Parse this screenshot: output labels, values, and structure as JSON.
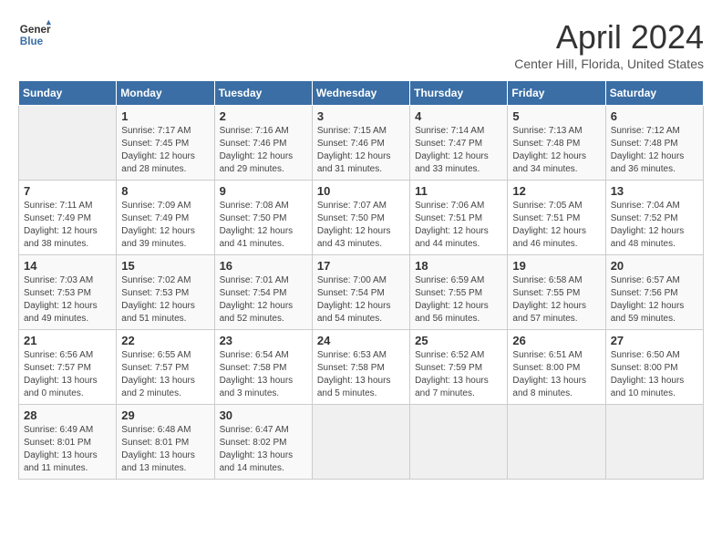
{
  "header": {
    "logo_line1": "General",
    "logo_line2": "Blue",
    "month_title": "April 2024",
    "subtitle": "Center Hill, Florida, United States"
  },
  "weekdays": [
    "Sunday",
    "Monday",
    "Tuesday",
    "Wednesday",
    "Thursday",
    "Friday",
    "Saturday"
  ],
  "weeks": [
    [
      {
        "day": "",
        "sunrise": "",
        "sunset": "",
        "daylight": ""
      },
      {
        "day": "1",
        "sunrise": "Sunrise: 7:17 AM",
        "sunset": "Sunset: 7:45 PM",
        "daylight": "Daylight: 12 hours and 28 minutes."
      },
      {
        "day": "2",
        "sunrise": "Sunrise: 7:16 AM",
        "sunset": "Sunset: 7:46 PM",
        "daylight": "Daylight: 12 hours and 29 minutes."
      },
      {
        "day": "3",
        "sunrise": "Sunrise: 7:15 AM",
        "sunset": "Sunset: 7:46 PM",
        "daylight": "Daylight: 12 hours and 31 minutes."
      },
      {
        "day": "4",
        "sunrise": "Sunrise: 7:14 AM",
        "sunset": "Sunset: 7:47 PM",
        "daylight": "Daylight: 12 hours and 33 minutes."
      },
      {
        "day": "5",
        "sunrise": "Sunrise: 7:13 AM",
        "sunset": "Sunset: 7:48 PM",
        "daylight": "Daylight: 12 hours and 34 minutes."
      },
      {
        "day": "6",
        "sunrise": "Sunrise: 7:12 AM",
        "sunset": "Sunset: 7:48 PM",
        "daylight": "Daylight: 12 hours and 36 minutes."
      }
    ],
    [
      {
        "day": "7",
        "sunrise": "Sunrise: 7:11 AM",
        "sunset": "Sunset: 7:49 PM",
        "daylight": "Daylight: 12 hours and 38 minutes."
      },
      {
        "day": "8",
        "sunrise": "Sunrise: 7:09 AM",
        "sunset": "Sunset: 7:49 PM",
        "daylight": "Daylight: 12 hours and 39 minutes."
      },
      {
        "day": "9",
        "sunrise": "Sunrise: 7:08 AM",
        "sunset": "Sunset: 7:50 PM",
        "daylight": "Daylight: 12 hours and 41 minutes."
      },
      {
        "day": "10",
        "sunrise": "Sunrise: 7:07 AM",
        "sunset": "Sunset: 7:50 PM",
        "daylight": "Daylight: 12 hours and 43 minutes."
      },
      {
        "day": "11",
        "sunrise": "Sunrise: 7:06 AM",
        "sunset": "Sunset: 7:51 PM",
        "daylight": "Daylight: 12 hours and 44 minutes."
      },
      {
        "day": "12",
        "sunrise": "Sunrise: 7:05 AM",
        "sunset": "Sunset: 7:51 PM",
        "daylight": "Daylight: 12 hours and 46 minutes."
      },
      {
        "day": "13",
        "sunrise": "Sunrise: 7:04 AM",
        "sunset": "Sunset: 7:52 PM",
        "daylight": "Daylight: 12 hours and 48 minutes."
      }
    ],
    [
      {
        "day": "14",
        "sunrise": "Sunrise: 7:03 AM",
        "sunset": "Sunset: 7:53 PM",
        "daylight": "Daylight: 12 hours and 49 minutes."
      },
      {
        "day": "15",
        "sunrise": "Sunrise: 7:02 AM",
        "sunset": "Sunset: 7:53 PM",
        "daylight": "Daylight: 12 hours and 51 minutes."
      },
      {
        "day": "16",
        "sunrise": "Sunrise: 7:01 AM",
        "sunset": "Sunset: 7:54 PM",
        "daylight": "Daylight: 12 hours and 52 minutes."
      },
      {
        "day": "17",
        "sunrise": "Sunrise: 7:00 AM",
        "sunset": "Sunset: 7:54 PM",
        "daylight": "Daylight: 12 hours and 54 minutes."
      },
      {
        "day": "18",
        "sunrise": "Sunrise: 6:59 AM",
        "sunset": "Sunset: 7:55 PM",
        "daylight": "Daylight: 12 hours and 56 minutes."
      },
      {
        "day": "19",
        "sunrise": "Sunrise: 6:58 AM",
        "sunset": "Sunset: 7:55 PM",
        "daylight": "Daylight: 12 hours and 57 minutes."
      },
      {
        "day": "20",
        "sunrise": "Sunrise: 6:57 AM",
        "sunset": "Sunset: 7:56 PM",
        "daylight": "Daylight: 12 hours and 59 minutes."
      }
    ],
    [
      {
        "day": "21",
        "sunrise": "Sunrise: 6:56 AM",
        "sunset": "Sunset: 7:57 PM",
        "daylight": "Daylight: 13 hours and 0 minutes."
      },
      {
        "day": "22",
        "sunrise": "Sunrise: 6:55 AM",
        "sunset": "Sunset: 7:57 PM",
        "daylight": "Daylight: 13 hours and 2 minutes."
      },
      {
        "day": "23",
        "sunrise": "Sunrise: 6:54 AM",
        "sunset": "Sunset: 7:58 PM",
        "daylight": "Daylight: 13 hours and 3 minutes."
      },
      {
        "day": "24",
        "sunrise": "Sunrise: 6:53 AM",
        "sunset": "Sunset: 7:58 PM",
        "daylight": "Daylight: 13 hours and 5 minutes."
      },
      {
        "day": "25",
        "sunrise": "Sunrise: 6:52 AM",
        "sunset": "Sunset: 7:59 PM",
        "daylight": "Daylight: 13 hours and 7 minutes."
      },
      {
        "day": "26",
        "sunrise": "Sunrise: 6:51 AM",
        "sunset": "Sunset: 8:00 PM",
        "daylight": "Daylight: 13 hours and 8 minutes."
      },
      {
        "day": "27",
        "sunrise": "Sunrise: 6:50 AM",
        "sunset": "Sunset: 8:00 PM",
        "daylight": "Daylight: 13 hours and 10 minutes."
      }
    ],
    [
      {
        "day": "28",
        "sunrise": "Sunrise: 6:49 AM",
        "sunset": "Sunset: 8:01 PM",
        "daylight": "Daylight: 13 hours and 11 minutes."
      },
      {
        "day": "29",
        "sunrise": "Sunrise: 6:48 AM",
        "sunset": "Sunset: 8:01 PM",
        "daylight": "Daylight: 13 hours and 13 minutes."
      },
      {
        "day": "30",
        "sunrise": "Sunrise: 6:47 AM",
        "sunset": "Sunset: 8:02 PM",
        "daylight": "Daylight: 13 hours and 14 minutes."
      },
      {
        "day": "",
        "sunrise": "",
        "sunset": "",
        "daylight": ""
      },
      {
        "day": "",
        "sunrise": "",
        "sunset": "",
        "daylight": ""
      },
      {
        "day": "",
        "sunrise": "",
        "sunset": "",
        "daylight": ""
      },
      {
        "day": "",
        "sunrise": "",
        "sunset": "",
        "daylight": ""
      }
    ]
  ]
}
